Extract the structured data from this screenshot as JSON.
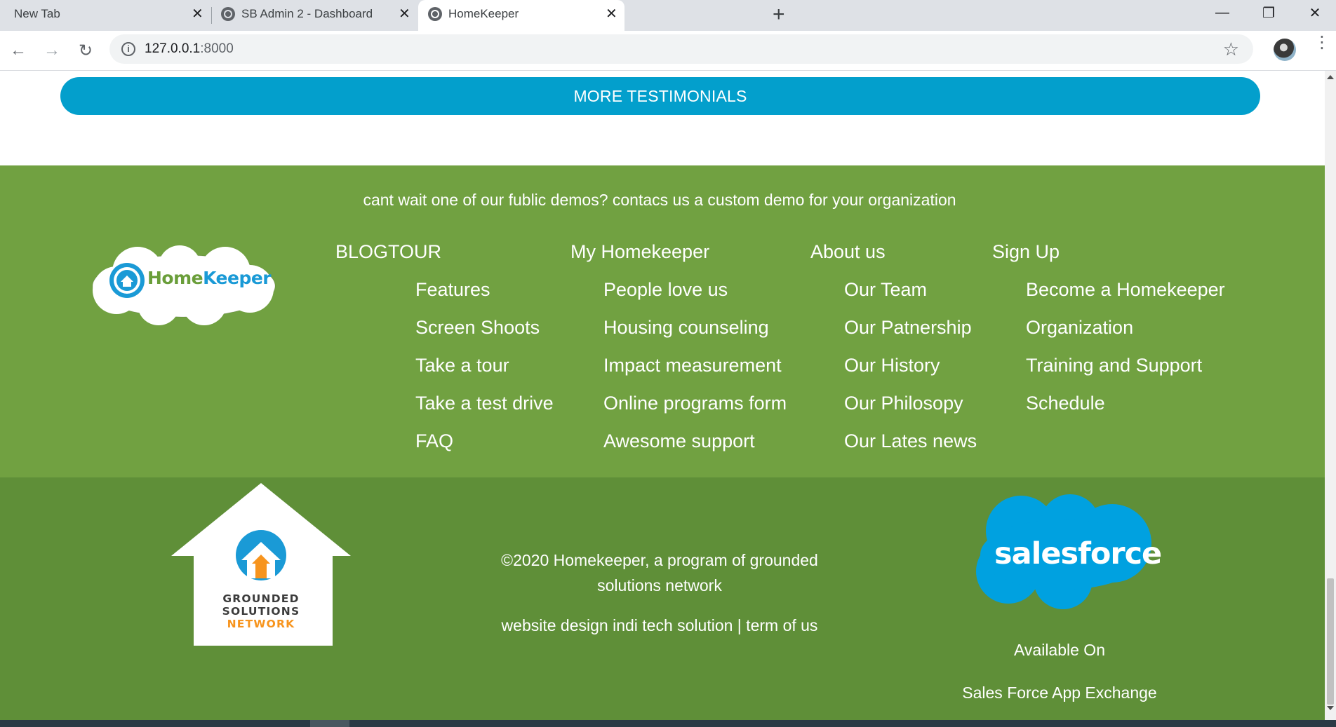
{
  "browser": {
    "tabs": [
      {
        "label": "New Tab"
      },
      {
        "label": "SB Admin 2 - Dashboard"
      },
      {
        "label": "HomeKeeper"
      }
    ],
    "new_tab_symbol": "+",
    "close_symbol": "✕",
    "url_host": "127.0.0.1",
    "url_port": ":8000",
    "info_symbol": "i",
    "star_symbol": "☆",
    "back_symbol": "←",
    "forward_symbol": "→",
    "reload_symbol": "↻",
    "minimize_symbol": "—",
    "restore_symbol": "❐",
    "close_window_symbol": "✕",
    "menu_symbol": "⋮"
  },
  "page": {
    "more_button_label": "MORE TESTIMONIALS",
    "cta_text": "cant wait one of our fublic demos? contacs us a custom demo for your organization",
    "homekeeper_logo": {
      "home": "Home",
      "keeper": "Keeper"
    },
    "columns": [
      {
        "heading": "BLOGTOUR",
        "links": [
          "Features",
          "Screen Shoots",
          "Take a tour",
          "Take a test drive",
          "FAQ"
        ]
      },
      {
        "heading": "My Homekeeper",
        "links": [
          "People love us",
          "Housing counseling",
          "Impact measurement",
          "Online programs form",
          "Awesome support"
        ]
      },
      {
        "heading": "About us",
        "links": [
          "Our Team",
          "Our Patnership",
          "Our History",
          "Our Philosopy",
          "Our Lates news"
        ]
      },
      {
        "heading": "Sign Up",
        "links": [
          "Become a Homekeeper",
          "Organization",
          "Training and Support",
          "Schedule"
        ]
      }
    ],
    "gsn_logo": {
      "line1": "GROUNDED",
      "line2": "SOLUTIONS",
      "line3": "NETWORK"
    },
    "copyright_line1": "©2020 Homekeeper, a program of grounded",
    "copyright_line2": "solutions network",
    "credits": "website design indi tech solution | term of us",
    "salesforce_word": "salesforce",
    "available_on": "Available On",
    "app_exchange": "Sales Force App Exchange"
  },
  "colors": {
    "button_blue": "#039fcc",
    "footer_top_green": "#71a141",
    "footer_bottom_green": "#5f8f38",
    "salesforce_blue": "#00a1e0"
  },
  "icons": [
    "globe-icon",
    "close-icon",
    "plus-icon",
    "back-arrow-icon",
    "forward-arrow-icon",
    "reload-icon",
    "info-icon",
    "star-icon",
    "avatar",
    "menu-dots-icon"
  ]
}
